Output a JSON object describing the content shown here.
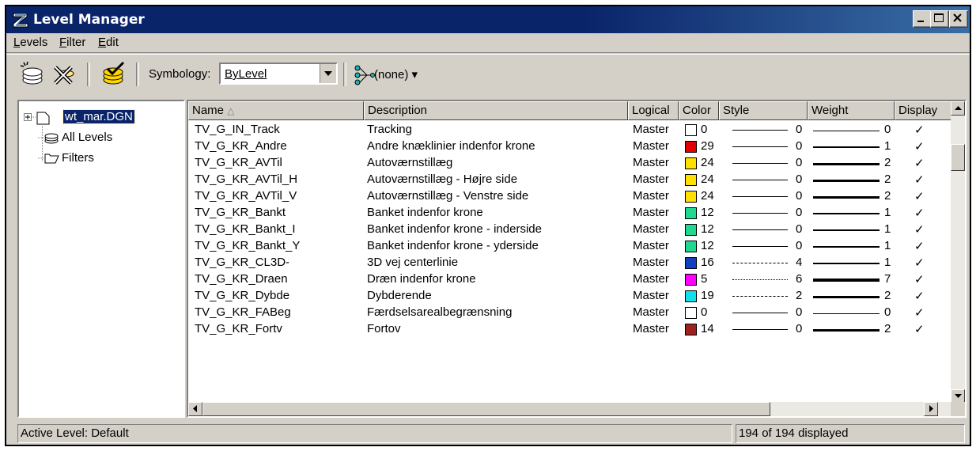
{
  "window": {
    "title": "Level Manager",
    "accent": "#0a246a"
  },
  "menu": [
    {
      "label": "Levels",
      "accel": "L"
    },
    {
      "label": "Filter",
      "accel": "F"
    },
    {
      "label": "Edit",
      "accel": "E"
    }
  ],
  "toolbar": {
    "symbology_label": "Symbology:",
    "symbology_value": "ByLevel",
    "filter_value": "(none)"
  },
  "tree": {
    "file": "wt_mar.DGN",
    "all_levels": "All Levels",
    "filters": "Filters"
  },
  "columns": {
    "name": "Name",
    "description": "Description",
    "logical": "Logical",
    "color": "Color",
    "style": "Style",
    "weight": "Weight",
    "display": "Display"
  },
  "levels": [
    {
      "name": "TV_G_IN_Track",
      "description": "Tracking",
      "logical": "Master",
      "color": "0",
      "color_hex": "#ffffff",
      "style": "0",
      "weight": "0",
      "display": "✓"
    },
    {
      "name": "TV_G_KR_Andre",
      "description": "Andre knæklinier indenfor krone",
      "logical": "Master",
      "color": "29",
      "color_hex": "#e00000",
      "style": "0",
      "weight": "1",
      "display": "✓"
    },
    {
      "name": "TV_G_KR_AVTil",
      "description": "Autoværnstillæg",
      "logical": "Master",
      "color": "24",
      "color_hex": "#ffe000",
      "style": "0",
      "weight": "2",
      "display": "✓"
    },
    {
      "name": "TV_G_KR_AVTil_H",
      "description": "Autoværnstillæg - Højre side",
      "logical": "Master",
      "color": "24",
      "color_hex": "#ffe000",
      "style": "0",
      "weight": "2",
      "display": "✓"
    },
    {
      "name": "TV_G_KR_AVTil_V",
      "description": "Autoværnstillæg - Venstre side",
      "logical": "Master",
      "color": "24",
      "color_hex": "#ffe000",
      "style": "0",
      "weight": "2",
      "display": "✓"
    },
    {
      "name": "TV_G_KR_Bankt",
      "description": "Banket indenfor krone",
      "logical": "Master",
      "color": "12",
      "color_hex": "#20d890",
      "style": "0",
      "weight": "1",
      "display": "✓"
    },
    {
      "name": "TV_G_KR_Bankt_I",
      "description": "Banket indenfor krone - inderside",
      "logical": "Master",
      "color": "12",
      "color_hex": "#20d890",
      "style": "0",
      "weight": "1",
      "display": "✓"
    },
    {
      "name": "TV_G_KR_Bankt_Y",
      "description": "Banket indenfor krone - yderside",
      "logical": "Master",
      "color": "12",
      "color_hex": "#20d890",
      "style": "0",
      "weight": "1",
      "display": "✓"
    },
    {
      "name": "TV_G_KR_CL3D-",
      "description": "3D vej centerlinie",
      "logical": "Master",
      "color": "16",
      "color_hex": "#1040c0",
      "style": "4",
      "weight": "1",
      "display": "✓"
    },
    {
      "name": "TV_G_KR_Draen",
      "description": "Dræn indenfor krone",
      "logical": "Master",
      "color": "5",
      "color_hex": "#ff00ff",
      "style": "6",
      "weight": "7",
      "display": "✓"
    },
    {
      "name": "TV_G_KR_Dybde",
      "description": "Dybderende",
      "logical": "Master",
      "color": "19",
      "color_hex": "#10e0f0",
      "style": "2",
      "weight": "2",
      "display": "✓"
    },
    {
      "name": "TV_G_KR_FABeg",
      "description": "Færdselsarealbegrænsning",
      "logical": "Master",
      "color": "0",
      "color_hex": "#ffffff",
      "style": "0",
      "weight": "0",
      "display": "✓"
    },
    {
      "name": "TV_G_KR_Fortv",
      "description": "Fortov",
      "logical": "Master",
      "color": "14",
      "color_hex": "#a02020",
      "style": "0",
      "weight": "2",
      "display": "✓"
    }
  ],
  "status": {
    "active_level": "Active Level: Default",
    "count": "194 of 194 displayed"
  }
}
